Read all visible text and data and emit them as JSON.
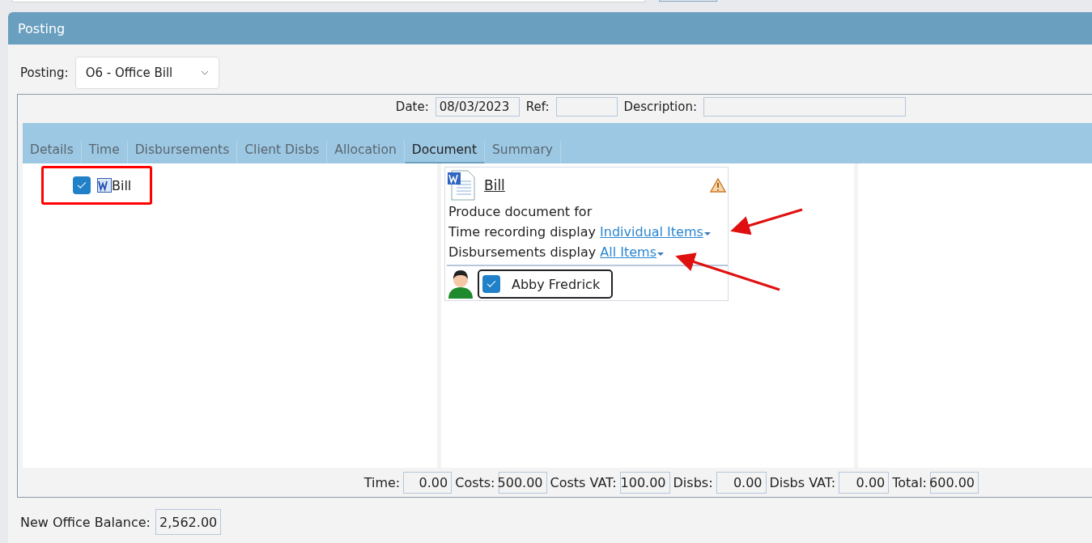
{
  "panel": {
    "title": "Posting"
  },
  "posting": {
    "label": "Posting:",
    "value": "O6 - Office Bill"
  },
  "header_fields": [
    {
      "label": "Date:",
      "value": "08/03/2023"
    },
    {
      "label": "Ref:"
    },
    {
      "label": "Description:"
    }
  ],
  "tabs": [
    {
      "label": "Details",
      "selected": false
    },
    {
      "label": "Time",
      "selected": false
    },
    {
      "label": "Disbursements",
      "selected": false
    },
    {
      "label": "Client Disbs",
      "selected": false
    },
    {
      "label": "Allocation",
      "selected": false
    },
    {
      "label": "Document",
      "selected": true
    },
    {
      "label": "Summary",
      "selected": false
    }
  ],
  "document_list": [
    {
      "label": "Bill",
      "checked": true
    }
  ],
  "document_card": {
    "title": "Bill",
    "intro": "Produce document for",
    "options": [
      {
        "label": "Time recording display",
        "value": "Individual Items"
      },
      {
        "label": "Disbursements display",
        "value": "All Items"
      }
    ],
    "recipients": [
      {
        "name": "Abby Fredrick",
        "checked": true
      }
    ]
  },
  "totals": [
    {
      "label": "Time:",
      "value": "0.00"
    },
    {
      "label": "Costs:",
      "value": "500.00"
    },
    {
      "label": "Costs VAT:",
      "value": "100.00"
    },
    {
      "label": "Disbs:",
      "value": "0.00"
    },
    {
      "label": "Disbs VAT:",
      "value": "0.00"
    },
    {
      "label": "Total:",
      "value": "600.00"
    }
  ],
  "balance": {
    "label": "New Office Balance:",
    "value": "2,562.00"
  }
}
